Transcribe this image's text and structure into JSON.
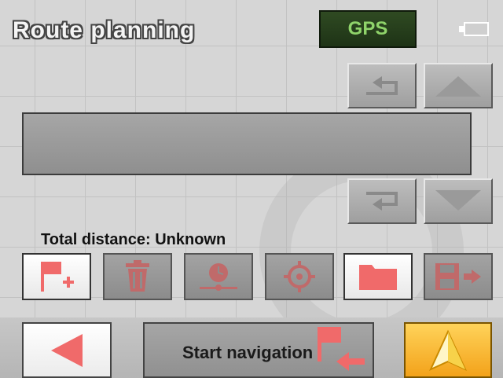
{
  "header": {
    "title": "Route planning",
    "gps_label": "GPS",
    "battery_icon": "battery-icon"
  },
  "nav": {
    "undo_icon": "undo-arrow-icon",
    "up_icon": "scroll-up-icon",
    "redo_icon": "redo-arrow-icon",
    "down_icon": "scroll-down-icon"
  },
  "route": {
    "total_distance": "Total distance: Unknown"
  },
  "toolbar": [
    {
      "name": "add-waypoint-button",
      "icon": "flag-plus-icon",
      "active": true
    },
    {
      "name": "delete-waypoint-button",
      "icon": "trash-icon",
      "active": false
    },
    {
      "name": "route-options-button",
      "icon": "clock-route-icon",
      "active": false
    },
    {
      "name": "current-position-button",
      "icon": "target-icon",
      "active": false
    },
    {
      "name": "open-route-button",
      "icon": "folder-icon",
      "active": true
    },
    {
      "name": "save-route-button",
      "icon": "save-disk-icon",
      "active": false
    }
  ],
  "bottom": {
    "back_icon": "back-arrow-icon",
    "start_navigation_label": "Start navigation",
    "start_icon": "flag-arrow-icon",
    "navigate_icon": "navigation-arrow-icon"
  },
  "colors": {
    "accent_red": "#f06a6a",
    "gps_green": "#8fd36a",
    "go_orange": "#f3a21a"
  }
}
